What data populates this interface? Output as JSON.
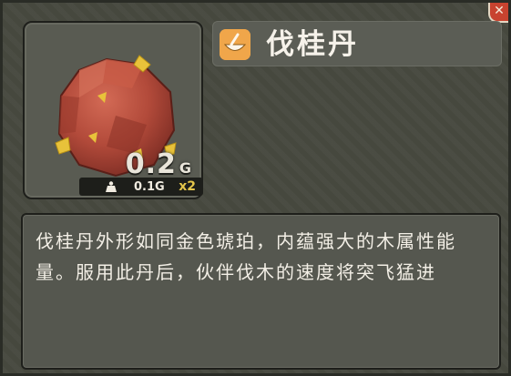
{
  "item": {
    "name": "伐桂丹",
    "weight_value": "0.2",
    "weight_unit": "G",
    "unit_weight": "0.1G",
    "count": "x2",
    "description": "伐桂丹外形如同金色琥珀，内蕴强大的木属性能量。服用此丹后，伙伴伐木的速度将突飞猛进"
  },
  "icons": {
    "item_art": "amber-pill-icon",
    "category": "mortar-bowl-icon",
    "weight": "weight-icon",
    "close": "close-icon"
  },
  "colors": {
    "panel_bg": "#47493f",
    "category_icon_bg": "#f0a64a",
    "count_text": "#e3c54a",
    "pill_body": "#b24a3a",
    "pill_crystals": "#e8c23a"
  }
}
